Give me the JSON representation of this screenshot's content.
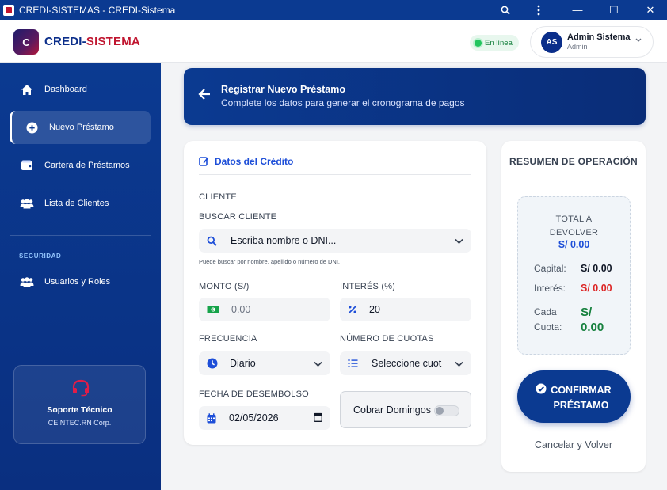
{
  "window": {
    "title": "CREDI-SISTEMAS - CREDI-Sistema",
    "controls": {
      "search": "search-icon",
      "menu": "more-vert-icon",
      "minimize": "—",
      "maximize": "☐",
      "close": "✕"
    }
  },
  "header": {
    "logo_letter": "C",
    "brand_part1": "CREDI-",
    "brand_part2": "SISTEMA",
    "status": "En línea",
    "user": {
      "initials": "AS",
      "name": "Admin Sistema",
      "role": "Admin"
    }
  },
  "sidebar": {
    "items": [
      {
        "label": "Dashboard",
        "icon": "home-icon"
      },
      {
        "label": "Nuevo Préstamo",
        "icon": "plus-circle-icon",
        "active": true
      },
      {
        "label": "Cartera de Préstamos",
        "icon": "wallet-icon"
      },
      {
        "label": "Lista de Clientes",
        "icon": "users-icon"
      }
    ],
    "section_security": "SEGURIDAD",
    "security_items": [
      {
        "label": "Usuarios y Roles",
        "icon": "users-icon"
      }
    ],
    "support": {
      "title": "Soporte Técnico",
      "company": "CEINTEC.RN Corp."
    }
  },
  "banner": {
    "title": "Registrar Nuevo Préstamo",
    "subtitle": "Complete los datos para generar el cronograma de pagos"
  },
  "form": {
    "section_title": "Datos del Crédito",
    "client_label": "CLIENTE",
    "search_label": "BUSCAR CLIENTE",
    "search_placeholder": "Escriba nombre o DNI...",
    "search_hint": "Puede buscar por nombre, apellido o número de DNI.",
    "amount_label": "MONTO (S/)",
    "amount_value": "0.00",
    "interest_label": "INTERÉS (%)",
    "interest_value": "20",
    "frequency_label": "FRECUENCIA",
    "frequency_value": "Diario",
    "installments_label": "NÚMERO DE CUOTAS",
    "installments_value": "Seleccione cuot",
    "date_label": "FECHA DE DESEMBOLSO",
    "date_value": "02/05/2026",
    "sundays_label": "Cobrar Domingos",
    "sundays_enabled": false
  },
  "summary": {
    "title": "RESUMEN DE OPERACIÓN",
    "total_label": "TOTAL A DEVOLVER",
    "total_value": "S/ 0.00",
    "capital_label": "Capital:",
    "capital_value": "S/ 0.00",
    "interest_label": "Interés:",
    "interest_value": "S/ 0.00",
    "cuota_label": "Cada Cuota:",
    "cuota_value": "S/ 0.00",
    "confirm_label": "CONFIRMAR PRÉSTAMO",
    "cancel_label": "Cancelar y Volver"
  },
  "colors": {
    "primary": "#0b3a91",
    "accent_red": "#c0152f",
    "link_blue": "#1d4ed8",
    "success_green": "#15803d",
    "danger_red": "#dc2626",
    "money_green": "#16a34a"
  }
}
